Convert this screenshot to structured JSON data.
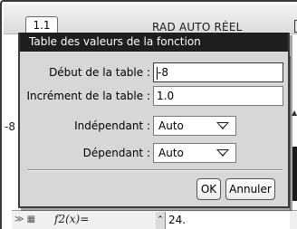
{
  "top_bar": {
    "tab_label": "1.1",
    "mode_text": "RAD AUTO RÉEL"
  },
  "background": {
    "left_mark": "-8",
    "entry_label": "f2(x)=",
    "entry_value": "24."
  },
  "dialog": {
    "title": "Table des valeurs de la fonction",
    "start": {
      "label": "Début de la table :",
      "value": "-8"
    },
    "step": {
      "label": "Incrément de la table :",
      "value": "1.0"
    },
    "independent": {
      "label": "Indépendant :",
      "selected": "Auto"
    },
    "dependent": {
      "label": "Dépendant :",
      "selected": "Auto"
    },
    "buttons": {
      "ok": "OK",
      "cancel": "Annuler"
    }
  }
}
